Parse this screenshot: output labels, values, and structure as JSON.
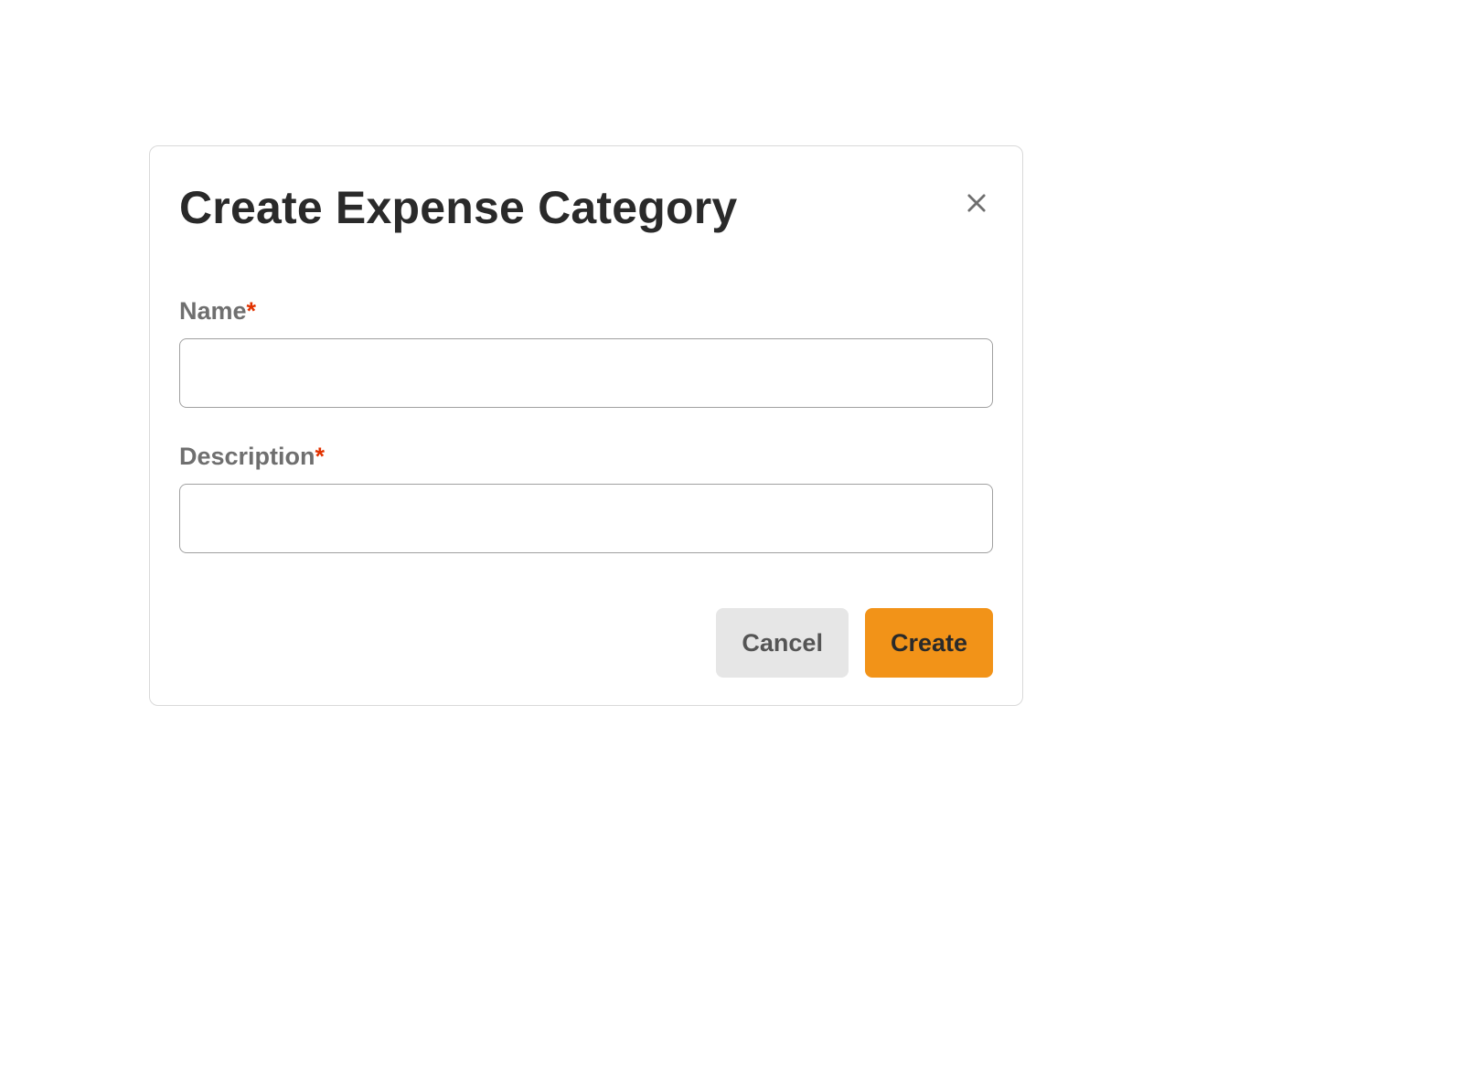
{
  "dialog": {
    "title": "Create Expense Category",
    "fields": {
      "name": {
        "label": "Name",
        "value": "",
        "required": true
      },
      "description": {
        "label": "Description",
        "value": "",
        "required": true
      }
    },
    "required_marker": "*",
    "buttons": {
      "cancel": "Cancel",
      "create": "Create"
    }
  }
}
